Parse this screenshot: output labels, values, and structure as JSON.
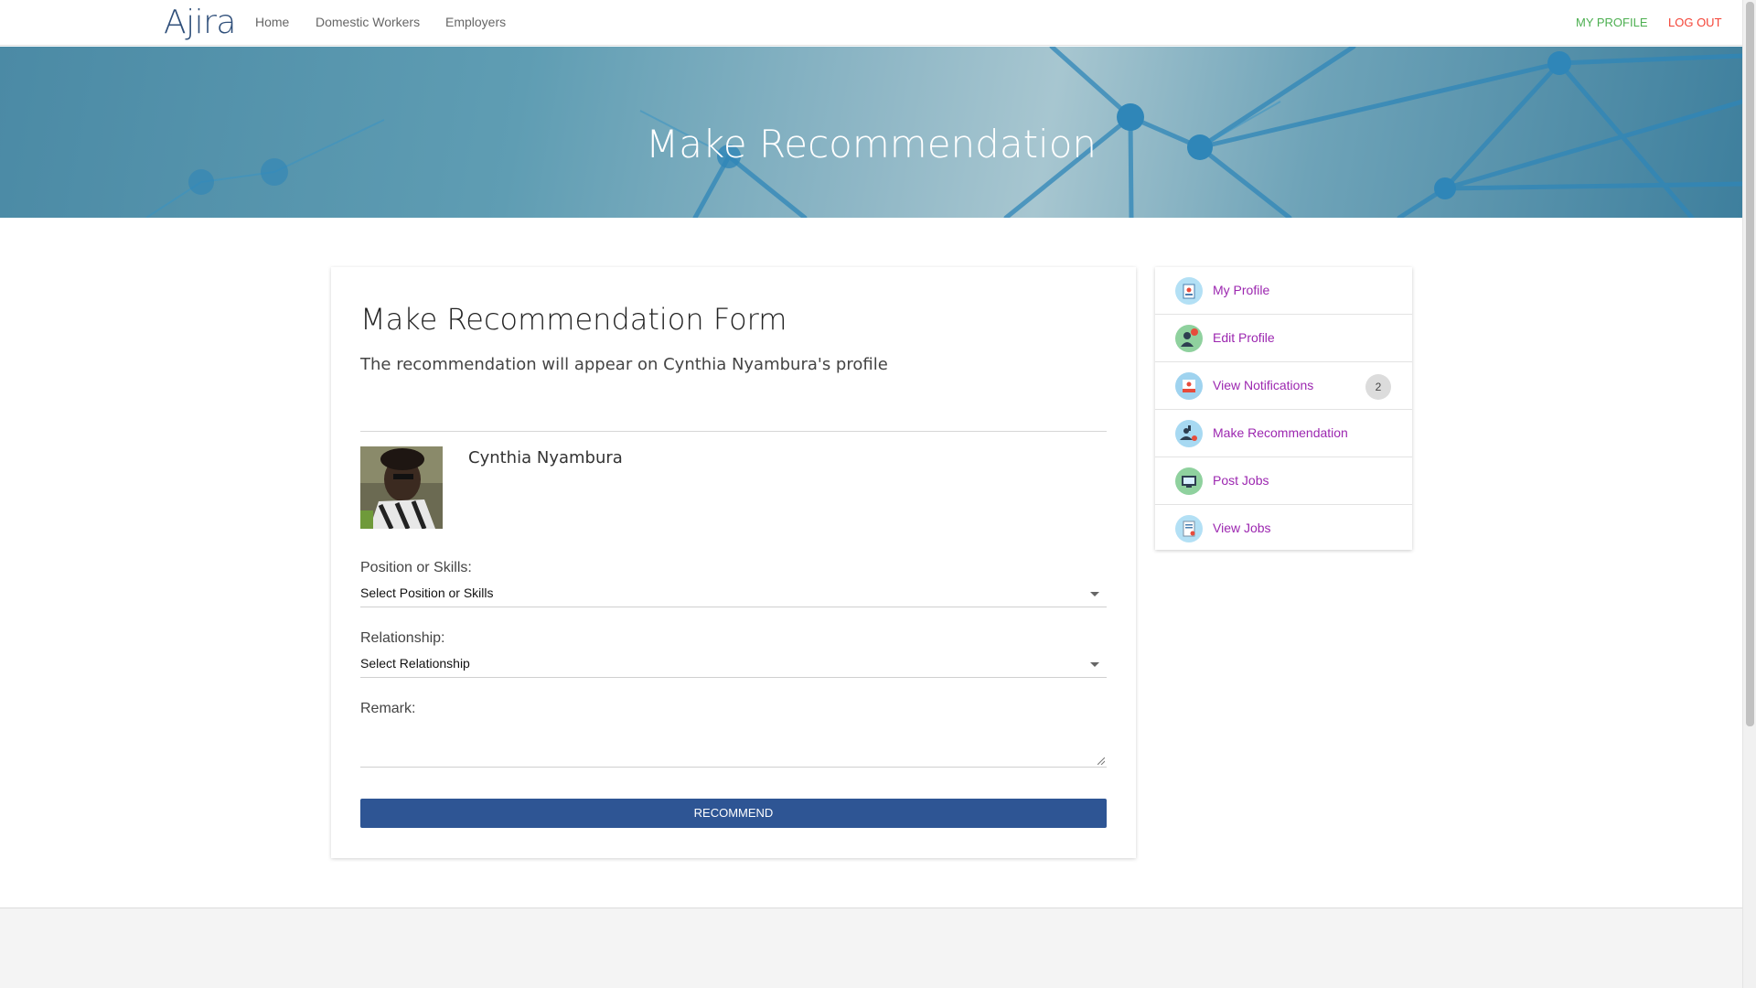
{
  "nav": {
    "brand": "Ajira",
    "links": [
      "Home",
      "Domestic Workers",
      "Employers"
    ],
    "my_profile": "MY PROFILE",
    "logout": "LOG OUT"
  },
  "hero": {
    "title": "Make Recommendation"
  },
  "form": {
    "title": "Make Recommendation Form",
    "subtitle": "The recommendation will appear on Cynthia Nyambura's profile",
    "person_name": "Cynthia Nyambura",
    "position_label": "Position or Skills:",
    "position_value": "Select Position or Skills",
    "relationship_label": "Relationship:",
    "relationship_value": "Select Relationship",
    "remark_label": "Remark:",
    "submit_label": "RECOMMEND"
  },
  "sidebar": {
    "items": [
      {
        "label": "My Profile",
        "icon": "profile-card-icon"
      },
      {
        "label": "Edit Profile",
        "icon": "edit-profile-icon"
      },
      {
        "label": "View Notifications",
        "icon": "notifications-icon",
        "badge": "2"
      },
      {
        "label": "Make Recommendation",
        "icon": "recommendation-icon"
      },
      {
        "label": "Post Jobs",
        "icon": "post-jobs-icon"
      },
      {
        "label": "View Jobs",
        "icon": "view-jobs-icon"
      }
    ]
  },
  "colors": {
    "brand": "#2f4f7a",
    "my_profile": "#4caf50",
    "logout": "#f44336",
    "sidebar_link": "#9c27b0",
    "button": "#2e5594"
  }
}
